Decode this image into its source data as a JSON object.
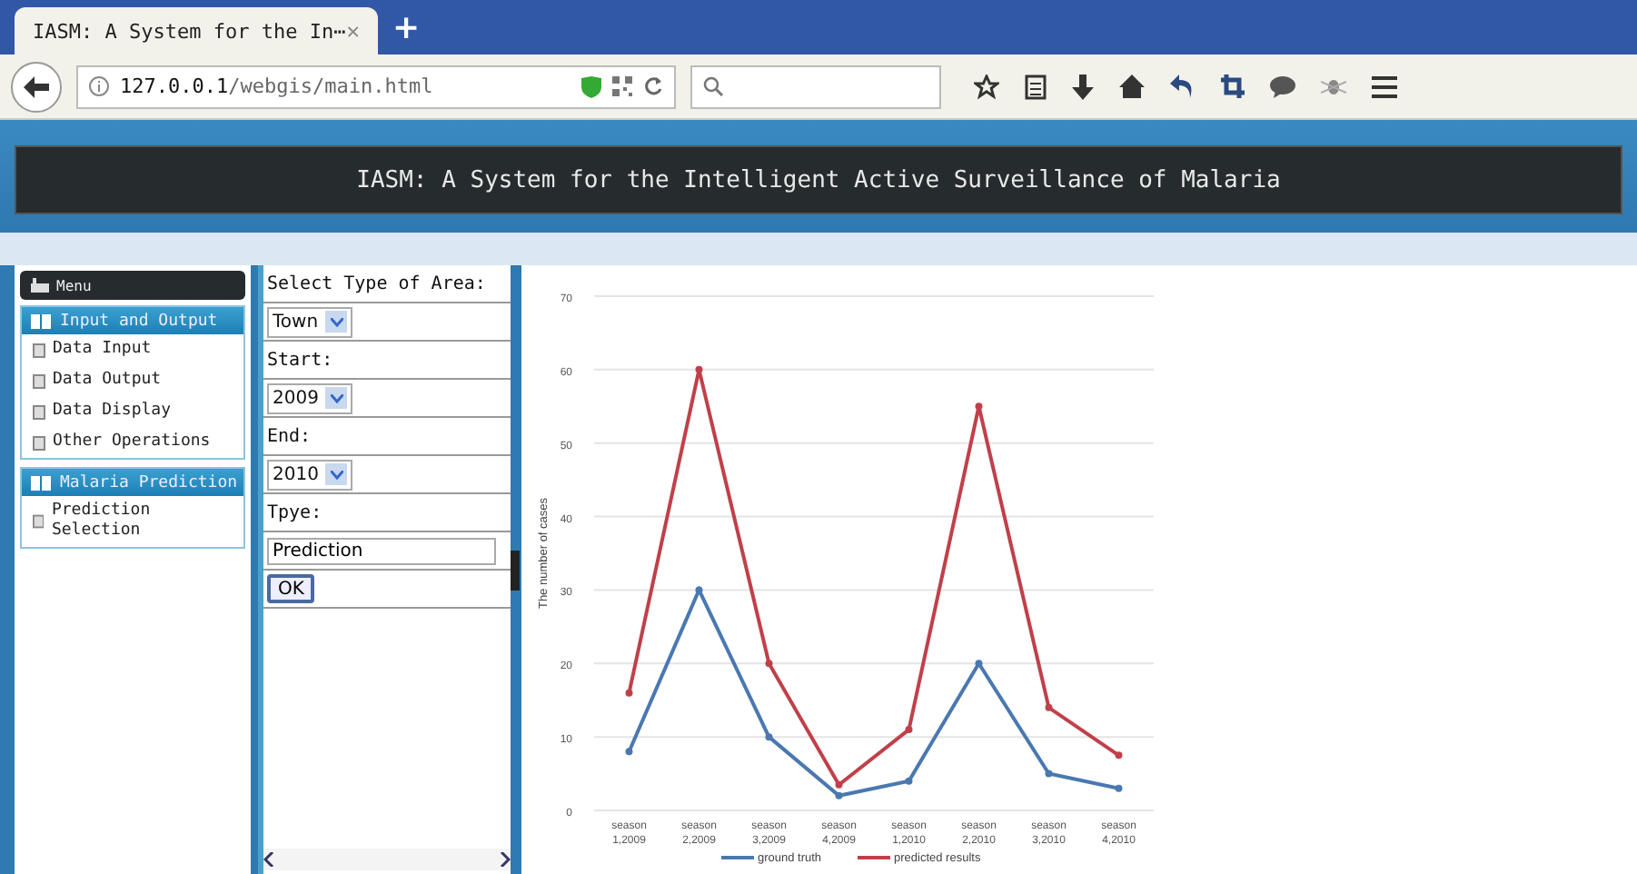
{
  "browser": {
    "tab_title": "IASM: A System for the In⋯",
    "new_tab": "+",
    "close": "✕",
    "url_host": "127.0.0.1",
    "url_path": "/webgis/main.html"
  },
  "header": {
    "title": "IASM: A System for the Intelligent Active Surveillance of Malaria"
  },
  "menu": {
    "title": "Menu",
    "sections": [
      {
        "title": "Input and Output",
        "items": [
          "Data Input",
          "Data Output",
          "Data Display",
          "Other Operations"
        ]
      },
      {
        "title": "Malaria Prediction",
        "items": [
          "Prediction Selection"
        ]
      }
    ]
  },
  "form": {
    "rows": [
      {
        "kind": "label",
        "text": "Select Type of Area:"
      },
      {
        "kind": "select",
        "value": "Town"
      },
      {
        "kind": "label",
        "text": "Start:"
      },
      {
        "kind": "select",
        "value": "2009"
      },
      {
        "kind": "label",
        "text": "End:"
      },
      {
        "kind": "select",
        "value": "2010"
      },
      {
        "kind": "label",
        "text": "Tpye:"
      },
      {
        "kind": "text",
        "value": "Prediction"
      },
      {
        "kind": "button",
        "text": "OK"
      }
    ]
  },
  "chart": {
    "chart_data": {
      "type": "line",
      "grid": true,
      "legend": true,
      "ylabel": "The number of cases",
      "categories": [
        "season 1,2009",
        "season 2,2009",
        "season 3,2009",
        "season 4,2009",
        "season 1,2010",
        "season 2,2010",
        "season 3,2010",
        "season 4,2010"
      ],
      "ylim": [
        0,
        70
      ],
      "yticks": [
        0,
        10,
        20,
        30,
        40,
        50,
        60,
        70
      ],
      "series": [
        {
          "name": "ground truth",
          "color": "#4a78b0",
          "marker": "circle",
          "values": [
            8,
            30,
            10,
            2,
            4,
            20,
            5,
            3
          ]
        },
        {
          "name": "predicted results",
          "color": "#c0404a",
          "marker": "circle",
          "values": [
            16,
            60,
            20,
            3.5,
            11,
            55,
            14,
            7.5
          ]
        }
      ]
    }
  }
}
